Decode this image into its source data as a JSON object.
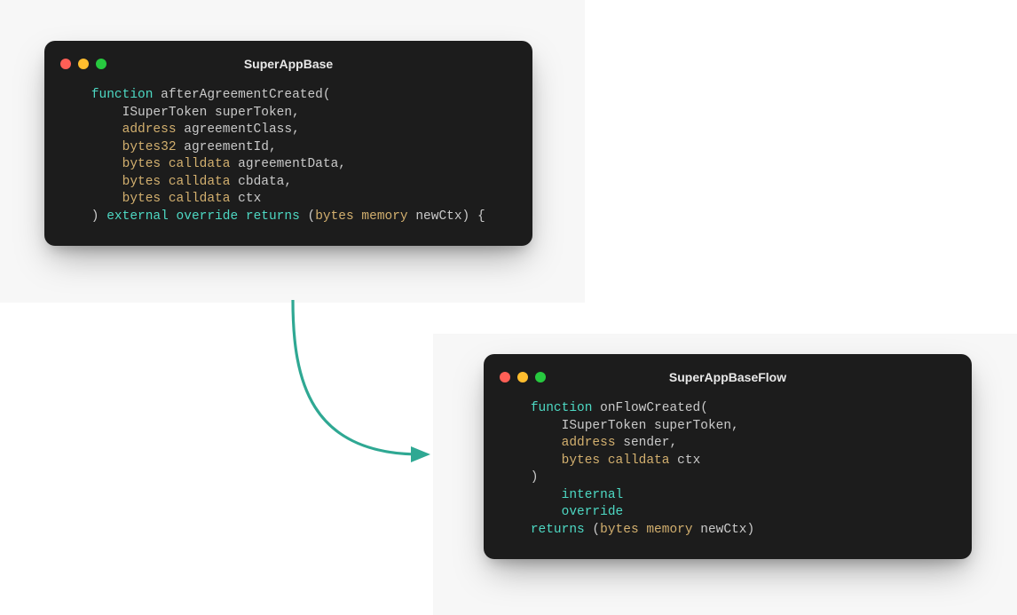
{
  "windowA": {
    "title": "SuperAppBase",
    "code": {
      "l1a": "    ",
      "l1_kw_function": "function",
      "l1b": " afterAgreementCreated(",
      "l2": "        ISuperToken superToken,",
      "l3a": "        ",
      "l3_kw_address": "address",
      "l3b": " agreementClass,",
      "l4a": "        ",
      "l4_kw_bytes32": "bytes32",
      "l4b": " agreementId,",
      "l5a": "        ",
      "l5_kw_bytes": "bytes",
      "l5_sp": " ",
      "l5_kw_calldata": "calldata",
      "l5b": " agreementData,",
      "l6a": "        ",
      "l6_kw_bytes": "bytes",
      "l6_sp": " ",
      "l6_kw_calldata": "calldata",
      "l6b": " cbdata,",
      "l7a": "        ",
      "l7_kw_bytes": "bytes",
      "l7_sp": " ",
      "l7_kw_calldata": "calldata",
      "l7b": " ctx",
      "l8a": "    ) ",
      "l8_kw_external": "external",
      "l8_sp1": " ",
      "l8_kw_override": "override",
      "l8_sp2": " ",
      "l8_kw_returns": "returns",
      "l8b": " (",
      "l8_kw_bytes": "bytes",
      "l8_sp3": " ",
      "l8_kw_memory": "memory",
      "l8c": " newCtx) {"
    }
  },
  "windowB": {
    "title": "SuperAppBaseFlow",
    "code": {
      "l1a": "    ",
      "l1_kw_function": "function",
      "l1b": " onFlowCreated(",
      "l2": "        ISuperToken superToken,",
      "l3a": "        ",
      "l3_kw_address": "address",
      "l3b": " sender,",
      "l4a": "        ",
      "l4_kw_bytes": "bytes",
      "l4_sp": " ",
      "l4_kw_calldata": "calldata",
      "l4b": " ctx",
      "l5": "    )",
      "l6a": "        ",
      "l6_kw_internal": "internal",
      "l7a": "        ",
      "l7_kw_override": "override",
      "l8a": "    ",
      "l8_kw_returns": "returns",
      "l8b": " (",
      "l8_kw_bytes": "bytes",
      "l8_sp": " ",
      "l8_kw_memory": "memory",
      "l8c": " newCtx)"
    }
  },
  "arrow": {
    "color": "#2fa893"
  }
}
